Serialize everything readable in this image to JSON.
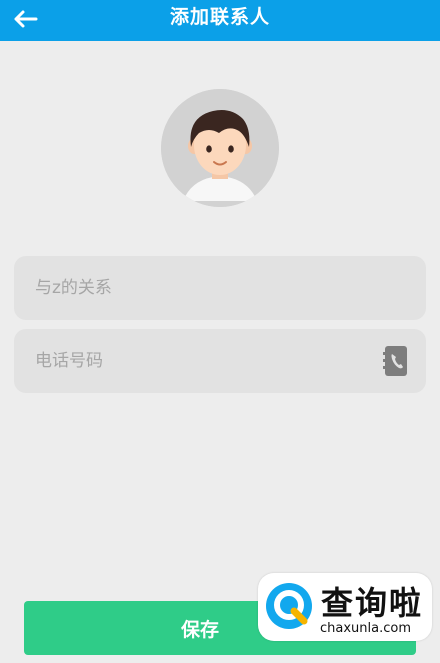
{
  "header": {
    "title": "添加联系人",
    "back_icon": "arrow-left-icon",
    "bg_color": "#0ba0e8"
  },
  "avatar": {
    "icon": "avatar-boy-icon"
  },
  "form": {
    "relation_placeholder": "与z的关系",
    "relation_value": "",
    "phone_placeholder": "电话号码",
    "phone_value": "",
    "phone_icon": "contact-book-phone-icon"
  },
  "save_button": {
    "label": "保存",
    "color": "#2fcc88"
  },
  "watermark": {
    "name": "查询啦",
    "url": "chaxunla.com"
  }
}
